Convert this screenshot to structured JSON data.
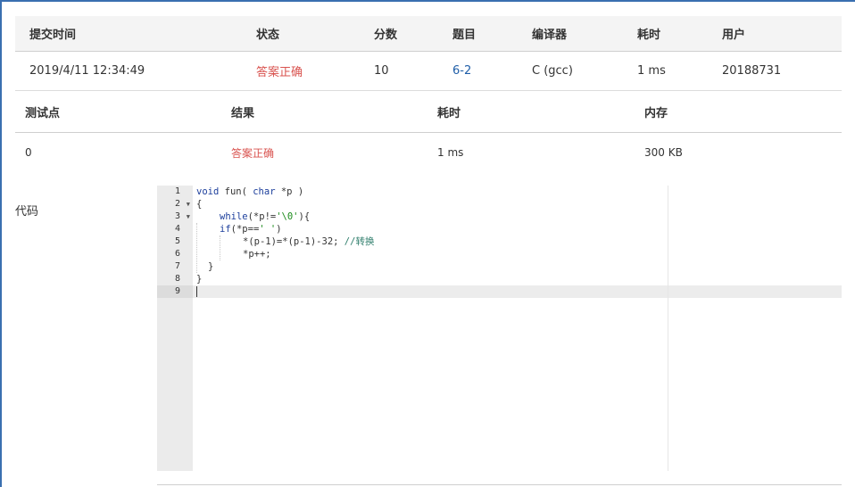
{
  "submission": {
    "headers": {
      "time": "提交时间",
      "status": "状态",
      "score": "分数",
      "problem": "题目",
      "compiler": "编译器",
      "elapsed": "耗时",
      "user": "用户"
    },
    "row": {
      "time": "2019/4/11 12:34:49",
      "status": "答案正确",
      "score": "10",
      "problem": "6-2",
      "compiler": "C (gcc)",
      "elapsed": "1 ms",
      "user": "20188731"
    }
  },
  "testcases": {
    "headers": {
      "id": "测试点",
      "result": "结果",
      "elapsed": "耗时",
      "memory": "内存"
    },
    "rows": [
      {
        "id": "0",
        "result": "答案正确",
        "elapsed": "1 ms",
        "memory": "300 KB"
      }
    ]
  },
  "code": {
    "label": "代码",
    "line_numbers": [
      "1",
      "2",
      "3",
      "4",
      "5",
      "6",
      "7",
      "8",
      "9"
    ],
    "tokens": {
      "l1_kw1": "void",
      "l1_a": " fun( ",
      "l1_kw2": "char",
      "l1_b": " *p )",
      "l2": "{",
      "l3_kw": "while",
      "l3_a": "(*p!=",
      "l3_str": "'\\0'",
      "l3_b": "){",
      "l4_kw": "if",
      "l4_a": "(*p==",
      "l4_str": "' '",
      "l4_b": ")",
      "l5_a": "*(p-1)=*(p-1)-32; ",
      "l5_cmt": "//转换",
      "l6": "*p++;",
      "l7": "}",
      "l8": "}"
    }
  },
  "colors": {
    "accepted": "#d9534f",
    "problem_link": "#1f5ea8",
    "keyword": "#1d3f9c"
  }
}
